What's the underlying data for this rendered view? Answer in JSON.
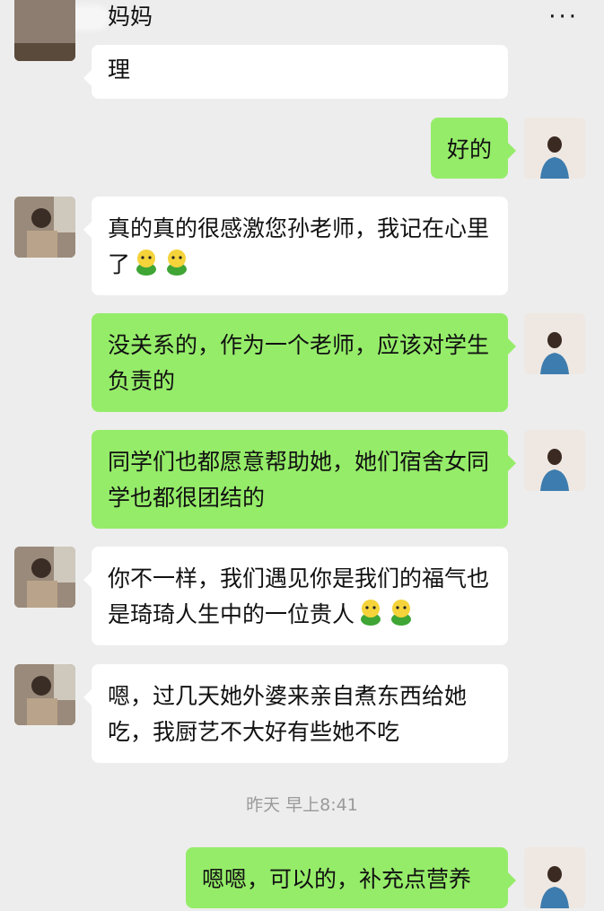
{
  "header": {
    "back_icon": "chevron-left-icon",
    "title": "妈妈",
    "more_label": "···"
  },
  "messages": [
    {
      "side": "in",
      "text": "理"
    },
    {
      "side": "out",
      "text": "好的"
    },
    {
      "side": "in",
      "text": "真的真的很感激您孙老师，我记在心里了",
      "emoji_count": 2
    },
    {
      "side": "out",
      "text": "没关系的，作为一个老师，应该对学生负责的"
    },
    {
      "side": "out",
      "text": "同学们也都愿意帮助她，她们宿舍女同学也都很团结的"
    },
    {
      "side": "in",
      "text": "你不一样，我们遇见你是我们的福气也是琦琦人生中的一位贵人",
      "emoji_count": 2
    },
    {
      "side": "in",
      "text": "嗯，过几天她外婆来亲自煮东西给她吃，我厨艺不大好有些她不吃"
    },
    {
      "side": "out",
      "text": "嗯嗯，可以的，补充点营养"
    }
  ],
  "timestamp": "昨天 早上8:41",
  "colors": {
    "background": "#ededed",
    "outgoing_bubble": "#95ec69",
    "incoming_bubble": "#ffffff"
  }
}
